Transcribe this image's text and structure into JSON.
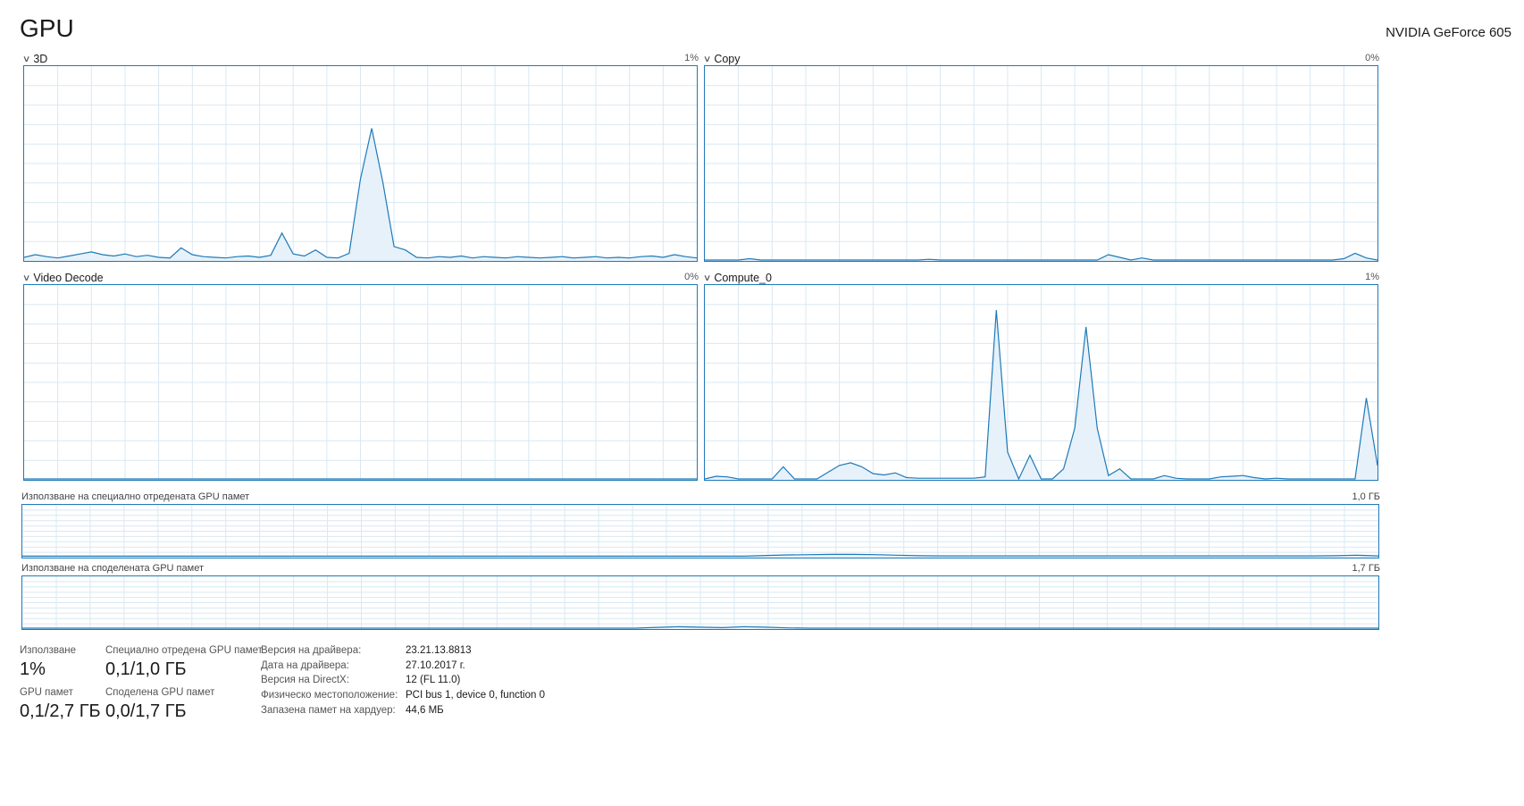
{
  "header": {
    "title": "GPU",
    "device": "NVIDIA GeForce 605"
  },
  "colors": {
    "accent": "#1e7ab8",
    "grid": "#d9e8f3",
    "fill": "#e6f1fa"
  },
  "engines": [
    {
      "name": "3D",
      "percent": "1%",
      "values": [
        0.4,
        0.8,
        0.5,
        0.3,
        0.6,
        0.9,
        1.2,
        0.8,
        0.6,
        0.9,
        0.5,
        0.7,
        0.4,
        0.3,
        1.8,
        0.8,
        0.5,
        0.4,
        0.3,
        0.5,
        0.6,
        0.4,
        0.7,
        4.0,
        0.9,
        0.6,
        1.5,
        0.4,
        0.3,
        1.0,
        12.0,
        19.5,
        11.5,
        2.0,
        1.5,
        0.4,
        0.3,
        0.5,
        0.4,
        0.6,
        0.3,
        0.5,
        0.4,
        0.3,
        0.5,
        0.4,
        0.3,
        0.4,
        0.5,
        0.3,
        0.4,
        0.5,
        0.3,
        0.4,
        0.3,
        0.5,
        0.6,
        0.4,
        0.8,
        0.5,
        0.3
      ]
    },
    {
      "name": "Copy",
      "percent": "0%",
      "values": [
        0,
        0,
        0,
        0,
        0.2,
        0,
        0,
        0,
        0,
        0,
        0,
        0,
        0,
        0,
        0,
        0,
        0,
        0,
        0,
        0,
        0.1,
        0,
        0,
        0,
        0,
        0,
        0,
        0,
        0,
        0,
        0,
        0,
        0,
        0,
        0,
        0,
        0.8,
        0.4,
        0,
        0.3,
        0,
        0,
        0,
        0,
        0,
        0,
        0,
        0,
        0,
        0,
        0,
        0,
        0,
        0,
        0,
        0,
        0,
        0.2,
        1.0,
        0.3,
        0
      ]
    },
    {
      "name": "Video Decode",
      "percent": "0%",
      "values": [
        0,
        0,
        0,
        0,
        0,
        0,
        0,
        0,
        0,
        0,
        0,
        0,
        0,
        0,
        0,
        0,
        0,
        0,
        0,
        0,
        0,
        0,
        0,
        0,
        0,
        0,
        0,
        0,
        0,
        0,
        0,
        0,
        0,
        0,
        0,
        0,
        0,
        0,
        0,
        0,
        0,
        0,
        0,
        0,
        0,
        0,
        0,
        0,
        0,
        0,
        0,
        0,
        0,
        0,
        0,
        0,
        0,
        0,
        0,
        0,
        0
      ]
    },
    {
      "name": "Compute_0",
      "percent": "1%",
      "values": [
        0,
        0.4,
        0.3,
        0,
        0,
        0,
        0,
        1.8,
        0,
        0,
        0,
        1.0,
        2.0,
        2.4,
        1.8,
        0.8,
        0.6,
        0.9,
        0.2,
        0.1,
        0.1,
        0.1,
        0.1,
        0.1,
        0.1,
        0.3,
        25.0,
        4.0,
        0,
        3.5,
        0,
        0,
        1.5,
        7.5,
        22.5,
        7.5,
        0.5,
        1.5,
        0,
        0,
        0,
        0.5,
        0.1,
        0,
        0,
        0,
        0.3,
        0.4,
        0.5,
        0.2,
        0,
        0.1,
        0,
        0,
        0,
        0,
        0,
        0,
        0,
        12.0,
        2.0
      ]
    }
  ],
  "memory_graphs": [
    {
      "label": "Използване на специално отредената GPU памет",
      "max": "1,0 ГБ",
      "values": [
        0.2,
        0.2,
        0.2,
        0.2,
        0.2,
        0.2,
        0.2,
        0.2,
        0.2,
        0.2,
        0.2,
        0.2,
        0.2,
        0.2,
        0.2,
        0.2,
        0.2,
        0.2,
        0.2,
        0.2,
        0.2,
        0.2,
        0.2,
        0.2,
        0.2,
        0.2,
        0.2,
        0.2,
        0.2,
        0.2,
        0.2,
        0.2,
        0.2,
        0.2,
        0.5,
        0.7,
        0.8,
        0.9,
        0.9,
        0.8,
        0.6,
        0.4,
        0.3,
        0.3,
        0.3,
        0.3,
        0.3,
        0.3,
        0.3,
        0.3,
        0.3,
        0.3,
        0.3,
        0.3,
        0.3,
        0.3,
        0.3,
        0.3,
        0.3,
        0.3,
        0.4,
        0.6,
        0.3
      ]
    },
    {
      "label": "Използване на споделената GPU памет",
      "max": "1,7 ГБ",
      "values": [
        0,
        0,
        0,
        0,
        0,
        0,
        0,
        0,
        0,
        0,
        0,
        0,
        0,
        0,
        0,
        0,
        0,
        0,
        0,
        0,
        0,
        0,
        0,
        0,
        0,
        0,
        0,
        0,
        0,
        0.3,
        0.6,
        0.4,
        0.2,
        0.6,
        0.4,
        0.1,
        0,
        0,
        0,
        0,
        0,
        0,
        0,
        0,
        0,
        0,
        0,
        0,
        0,
        0,
        0,
        0,
        0,
        0,
        0,
        0,
        0,
        0,
        0,
        0,
        0,
        0,
        0
      ]
    }
  ],
  "stats": {
    "utilization": {
      "label": "Използване",
      "value": "1%"
    },
    "dedicated": {
      "label": "Специално отредена GPU памет",
      "value": "0,1/1,0 ГБ"
    },
    "gpu_memory": {
      "label": "GPU памет",
      "value": "0,1/2,7 ГБ"
    },
    "shared": {
      "label": "Споделена GPU памет",
      "value": "0,0/1,7 ГБ"
    }
  },
  "info": [
    {
      "label": "Версия на драйвера:",
      "value": "23.21.13.8813"
    },
    {
      "label": "Дата на драйвера:",
      "value": "27.10.2017 г."
    },
    {
      "label": "Версия на DirectX:",
      "value": "12 (FL 11.0)"
    },
    {
      "label": "Физическо местоположение:",
      "value": "PCI bus 1, device 0, function 0"
    },
    {
      "label": "Запазена памет на хардуер:",
      "value": "44,6 МБ"
    }
  ]
}
